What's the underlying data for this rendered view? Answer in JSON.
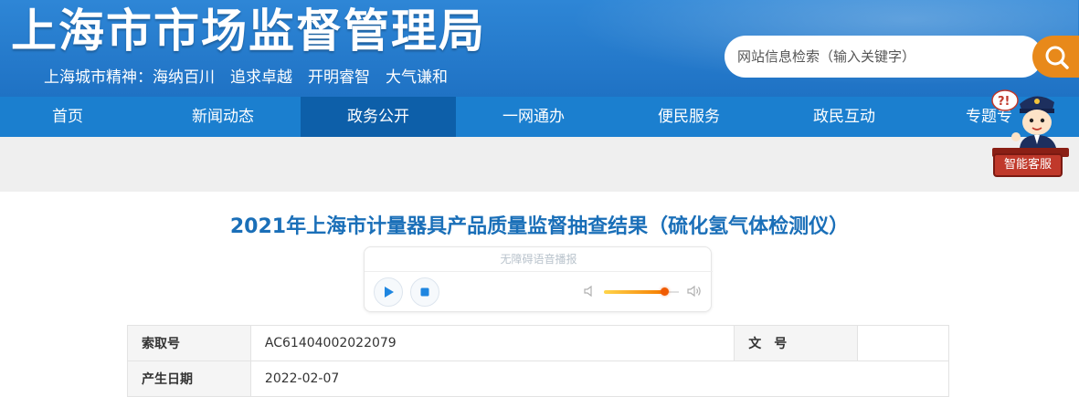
{
  "header": {
    "site_title": "上海市市场监督管理局",
    "motto": "上海城市精神：海纳百川　追求卓越　开明睿智　大气谦和",
    "search_placeholder": "网站信息检索（输入关键字）",
    "search_icon": "search-icon"
  },
  "nav": {
    "items": [
      {
        "label": "首页",
        "active": false
      },
      {
        "label": "新闻动态",
        "active": false
      },
      {
        "label": "政务公开",
        "active": true
      },
      {
        "label": "一网通办",
        "active": false
      },
      {
        "label": "便民服务",
        "active": false
      },
      {
        "label": "政民互动",
        "active": false
      },
      {
        "label": "专题专",
        "active": false
      }
    ]
  },
  "assistant": {
    "label": "智能客服",
    "icon": "customer-service-mascot-icon"
  },
  "article": {
    "title": "2021年上海市计量器具产品质量监督抽查结果（硫化氢气体检测仪）"
  },
  "player": {
    "label": "无障碍语音播报",
    "volume": 0.8,
    "accent_color": "#f05a00"
  },
  "info": {
    "rows": [
      {
        "k1": "索取号",
        "v1": "AC61404002022079",
        "k2": "文　号",
        "v2": ""
      },
      {
        "k1": "产生日期",
        "v1": "2022-02-07"
      }
    ]
  },
  "colors": {
    "header_blue": "#1f72c4",
    "nav_blue": "#1b7fcf",
    "nav_active": "#0d5fa9",
    "search_orange": "#e8891a",
    "title_blue": "#1a6fb8"
  }
}
